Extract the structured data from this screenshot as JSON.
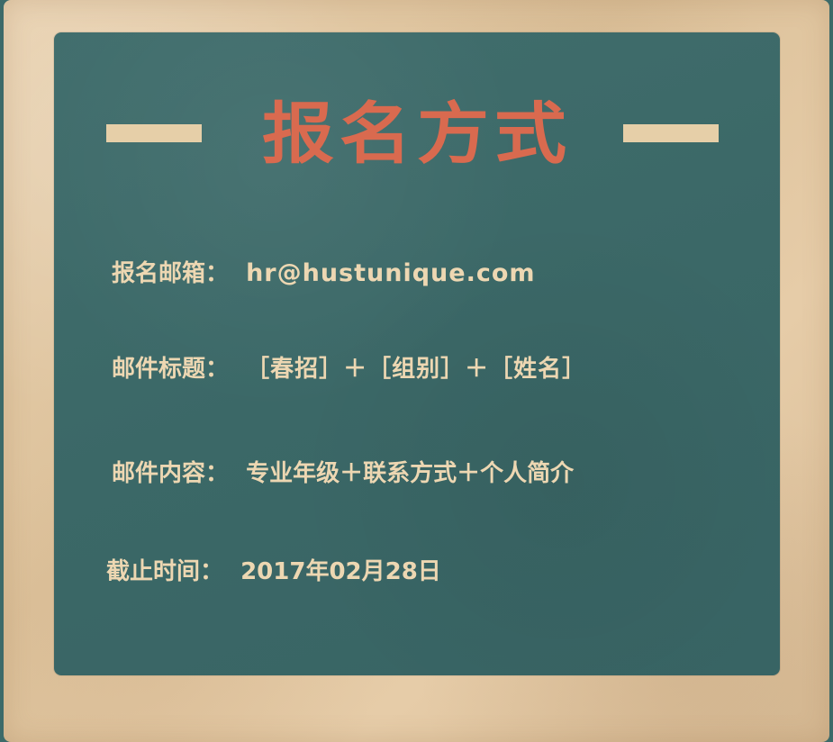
{
  "title": "报名方式",
  "rows": [
    {
      "label": "报名邮箱：",
      "value": "hr@hustunique.com"
    },
    {
      "label": "邮件标题：",
      "value": "［春招］＋［组别］＋［姓名］"
    },
    {
      "label": "邮件内容：",
      "value": "专业年级＋联系方式＋个人简介"
    },
    {
      "label": "截止时间：",
      "value": "2017年02月28日"
    }
  ],
  "colors": {
    "board": "#3c6a69",
    "title": "#d96a4f",
    "text": "#edd7b2",
    "frame": "#e2c7a1"
  }
}
